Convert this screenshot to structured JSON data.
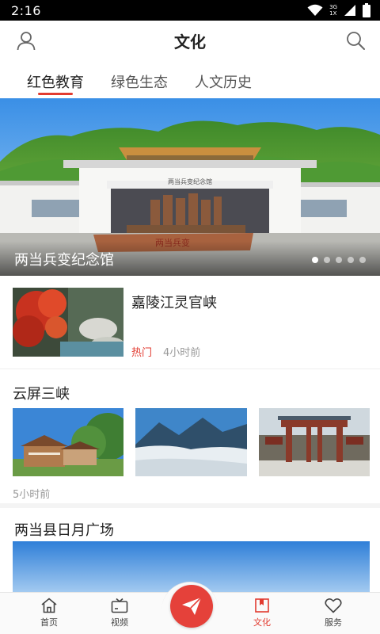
{
  "status_bar": {
    "time": "2:16",
    "network_top": "3G",
    "network_bottom": "1X",
    "icons": [
      "wifi-icon",
      "signal-icon",
      "battery-icon"
    ]
  },
  "header": {
    "title": "文化",
    "left_icon": "user-icon",
    "right_icon": "search-icon"
  },
  "tabs": [
    {
      "label": "红色教育",
      "active": true
    },
    {
      "label": "绿色生态",
      "active": false
    },
    {
      "label": "人文历史",
      "active": false
    }
  ],
  "hero": {
    "caption": "两当兵变纪念馆",
    "building_sign": "两当兵变纪念馆",
    "stone_inscription": "两当兵变",
    "slide_count": 5,
    "active_slide": 1
  },
  "articles": [
    {
      "title": "嘉陵江灵官峡",
      "tag": "热门",
      "time": "4小时前"
    },
    {
      "title": "云屏三峡",
      "time": "5小时前"
    },
    {
      "title": "两当县日月广场"
    }
  ],
  "bottom_nav": [
    {
      "label": "首页",
      "icon": "home-icon",
      "active": false
    },
    {
      "label": "视频",
      "icon": "tv-icon",
      "active": false
    },
    {
      "label": "",
      "icon": "paper-plane-icon",
      "active": false
    },
    {
      "label": "文化",
      "icon": "book-icon",
      "active": true
    },
    {
      "label": "服务",
      "icon": "heart-icon",
      "active": false
    }
  ],
  "colors": {
    "accent": "#e23b30",
    "status_bar": "#000000",
    "muted_text": "#999999"
  }
}
